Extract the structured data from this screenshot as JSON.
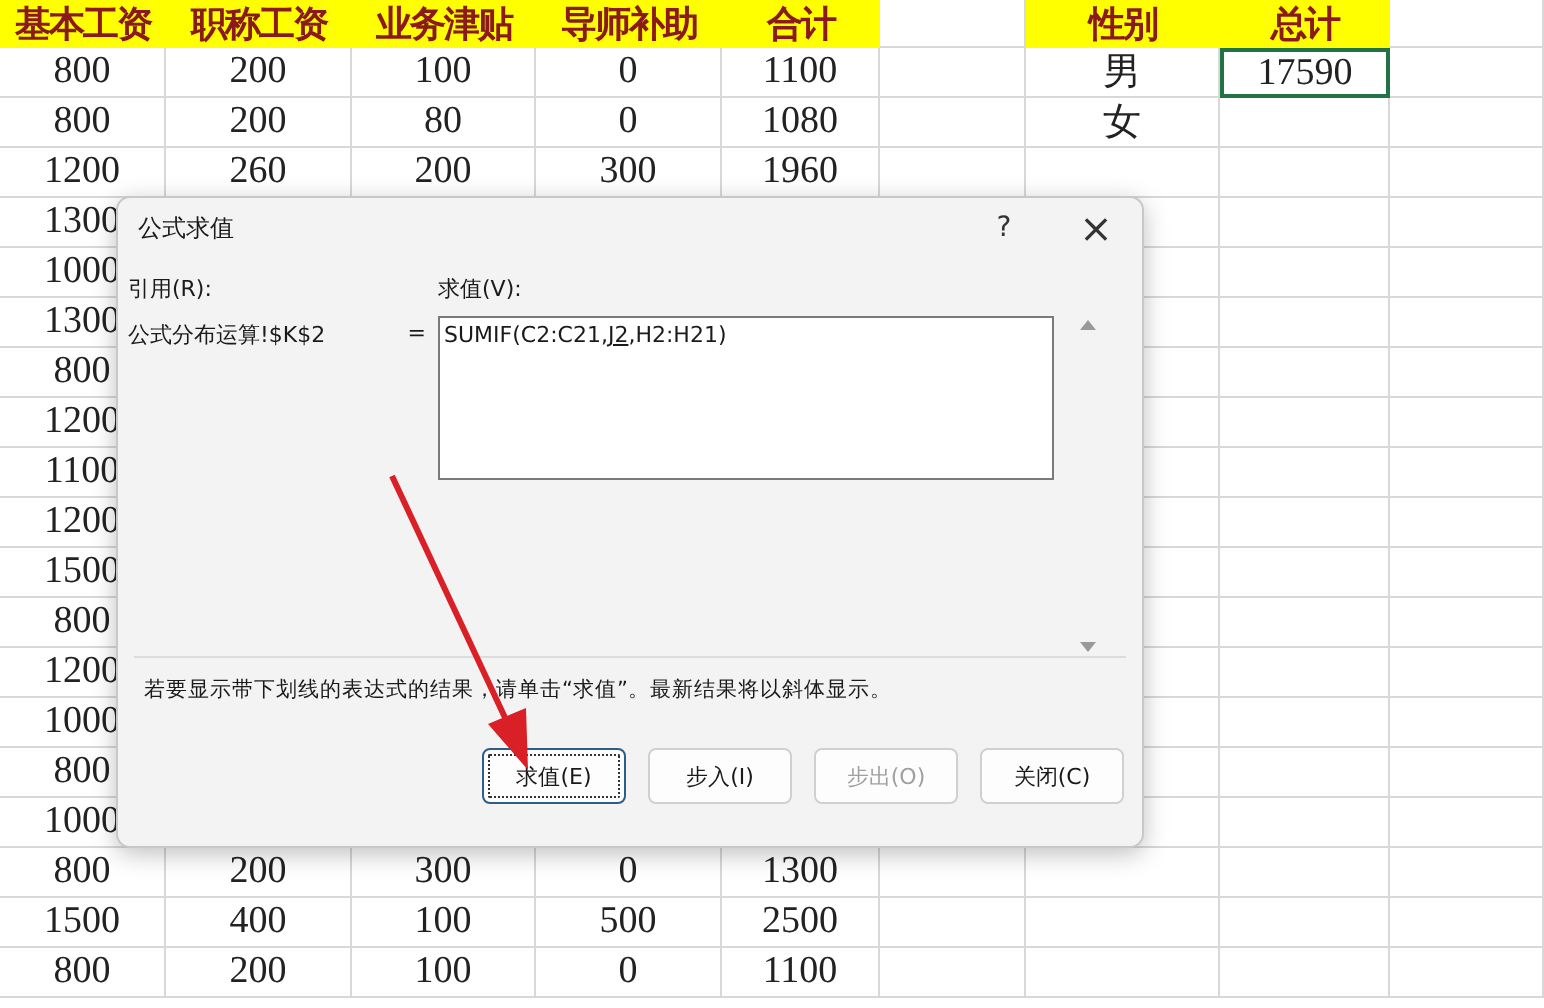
{
  "sheet": {
    "columns": [
      {
        "header": "基本工资",
        "kind": "data"
      },
      {
        "header": "职称工资",
        "kind": "data"
      },
      {
        "header": "业务津贴",
        "kind": "data"
      },
      {
        "header": "导师补助",
        "kind": "data"
      },
      {
        "header": "合计",
        "kind": "data"
      },
      {
        "kind": "blank"
      },
      {
        "header": "性别",
        "kind": "data"
      },
      {
        "header": "总计",
        "kind": "data"
      },
      {
        "kind": "blank"
      }
    ],
    "rows": [
      {
        "cells": [
          {
            "text": "800",
            "selected": false
          },
          {
            "text": "200",
            "selected": false
          },
          {
            "text": "100",
            "selected": false
          },
          {
            "text": "0",
            "selected": false
          },
          {
            "text": "1100",
            "selected": false
          },
          {
            "selected": false
          },
          {
            "text": "男",
            "selected": false
          },
          {
            "text": "17590",
            "selected": true
          },
          {
            "selected": false
          }
        ]
      },
      {
        "cells": [
          {
            "text": "800",
            "selected": false
          },
          {
            "text": "200",
            "selected": false
          },
          {
            "text": "80",
            "selected": false
          },
          {
            "text": "0",
            "selected": false
          },
          {
            "text": "1080",
            "selected": false
          },
          {
            "selected": false
          },
          {
            "text": "女",
            "selected": false
          },
          {
            "selected": false
          },
          {
            "selected": false
          }
        ]
      },
      {
        "cells": [
          {
            "text": "1200",
            "selected": false
          },
          {
            "text": "260",
            "selected": false
          },
          {
            "text": "200",
            "selected": false
          },
          {
            "text": "300",
            "selected": false
          },
          {
            "text": "1960",
            "selected": false
          },
          {
            "selected": false
          },
          {
            "selected": false
          },
          {
            "selected": false
          },
          {
            "selected": false
          }
        ]
      },
      {
        "cells": [
          {
            "text": "1300",
            "selected": false
          }
        ]
      },
      {
        "cells": [
          {
            "text": "1000",
            "selected": false
          }
        ]
      },
      {
        "cells": [
          {
            "text": "1300",
            "selected": false
          }
        ]
      },
      {
        "cells": [
          {
            "text": "800",
            "selected": false
          }
        ]
      },
      {
        "cells": [
          {
            "text": "1200",
            "selected": false
          }
        ]
      },
      {
        "cells": [
          {
            "text": "1100",
            "selected": false
          }
        ]
      },
      {
        "cells": [
          {
            "text": "1200",
            "selected": false
          }
        ]
      },
      {
        "cells": [
          {
            "text": "1500",
            "selected": false
          }
        ]
      },
      {
        "cells": [
          {
            "text": "800",
            "selected": false
          }
        ]
      },
      {
        "cells": [
          {
            "text": "1200",
            "selected": false
          }
        ]
      },
      {
        "cells": [
          {
            "text": "1000",
            "selected": false
          }
        ]
      },
      {
        "cells": [
          {
            "text": "800",
            "selected": false
          }
        ]
      },
      {
        "cells": [
          {
            "text": "1000",
            "selected": false
          }
        ]
      },
      {
        "cells": [
          {
            "text": "800",
            "selected": false
          },
          {
            "text": "200",
            "selected": false
          },
          {
            "text": "300",
            "selected": false
          },
          {
            "text": "0",
            "selected": false
          },
          {
            "text": "1300",
            "selected": false
          },
          {
            "selected": false
          },
          {
            "selected": false
          },
          {
            "selected": false
          },
          {
            "selected": false
          }
        ]
      },
      {
        "cells": [
          {
            "text": "1500",
            "selected": false
          },
          {
            "text": "400",
            "selected": false
          },
          {
            "text": "100",
            "selected": false
          },
          {
            "text": "500",
            "selected": false
          },
          {
            "text": "2500",
            "selected": false
          },
          {
            "selected": false
          },
          {
            "selected": false
          },
          {
            "selected": false
          },
          {
            "selected": false
          }
        ]
      },
      {
        "cells": [
          {
            "text": "800",
            "selected": false
          },
          {
            "text": "200",
            "selected": false
          },
          {
            "text": "100",
            "selected": false
          },
          {
            "text": "0",
            "selected": false
          },
          {
            "text": "1100",
            "selected": false
          },
          {
            "selected": false
          },
          {
            "selected": false
          },
          {
            "selected": false
          },
          {
            "selected": false
          }
        ]
      }
    ]
  },
  "dialog": {
    "title": "公式求值",
    "help": "?",
    "close": "×",
    "reference_label": "引用(R):",
    "reference": "公式分布运算!$K$2",
    "equals": "=",
    "evaluation_label": "求值(V):",
    "formula": [
      {
        "text": "SUMIF(C2:C21,",
        "underlined": false
      },
      {
        "text": "J2",
        "underlined": true
      },
      {
        "text": ",H2:H21)",
        "underlined": false
      }
    ],
    "note": "若要显示带下划线的表达式的结果，请单击“求值”。最新结果将以斜体显示。",
    "buttons": [
      {
        "label": "求值(E)",
        "focused": true,
        "disabled": false
      },
      {
        "label": "步入(I)",
        "focused": false,
        "disabled": false
      },
      {
        "label": "步出(O)",
        "focused": false,
        "disabled": true
      },
      {
        "label": "关闭(C)",
        "focused": false,
        "disabled": false
      }
    ]
  }
}
